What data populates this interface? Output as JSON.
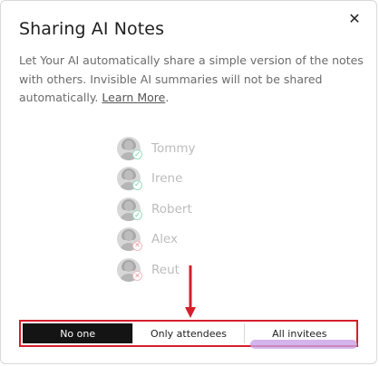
{
  "dialog": {
    "title": "Sharing AI Notes",
    "description": "Let Your AI automatically share a simple version of the notes with others. Invisible AI summaries will not be shared automatically.",
    "learn_more_label": "Learn More",
    "close_icon": "close-icon"
  },
  "recipients": [
    {
      "name": "Tommy",
      "status": "included"
    },
    {
      "name": "Irene",
      "status": "included"
    },
    {
      "name": "Robert",
      "status": "included"
    },
    {
      "name": "Alex",
      "status": "excluded"
    },
    {
      "name": "Reut",
      "status": "excluded"
    }
  ],
  "share_options": {
    "items": [
      "No one",
      "Only attendees",
      "All invitees"
    ],
    "selected": "No one"
  },
  "colors": {
    "selected_bg": "#141414",
    "highlight_outline": "#d61e2b",
    "included_check": "#64c7a0",
    "excluded_x": "#e09aa0"
  }
}
